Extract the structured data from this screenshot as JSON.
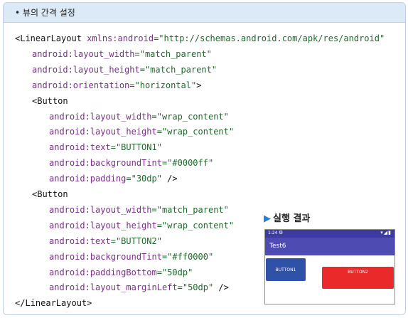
{
  "header": {
    "bullet": "•",
    "title": "뷰의 간격 설정"
  },
  "code_lines": [
    [
      {
        "t": "<LinearLayout ",
        "c": "k"
      },
      {
        "t": "xmlns:android",
        "c": "a"
      },
      {
        "t": "=\"http://schemas.android.com/apk/res/android\"",
        "c": "v"
      }
    ],
    [
      {
        "t": "android:",
        "c": "a"
      },
      {
        "t": "layout_width",
        "c": "a"
      },
      {
        "t": "=\"match_parent\"",
        "c": "v"
      }
    ],
    [
      {
        "t": "android:",
        "c": "a"
      },
      {
        "t": "layout_height",
        "c": "a"
      },
      {
        "t": "=\"match_parent\"",
        "c": "v"
      }
    ],
    [
      {
        "t": "android:",
        "c": "a"
      },
      {
        "t": "orientation",
        "c": "a"
      },
      {
        "t": "=\"horizontal\"",
        "c": "v"
      },
      {
        "t": ">",
        "c": "k"
      }
    ],
    [
      {
        "t": "<Button",
        "c": "k"
      }
    ],
    [
      {
        "t": "android:",
        "c": "a"
      },
      {
        "t": "layout_width",
        "c": "a"
      },
      {
        "t": "=\"wrap_content\"",
        "c": "v"
      }
    ],
    [
      {
        "t": "android:",
        "c": "a"
      },
      {
        "t": "layout_height",
        "c": "a"
      },
      {
        "t": "=\"wrap_content\"",
        "c": "v"
      }
    ],
    [
      {
        "t": "android:",
        "c": "a"
      },
      {
        "t": "text",
        "c": "a"
      },
      {
        "t": "=\"BUTTON1\"",
        "c": "v"
      }
    ],
    [
      {
        "t": "android:",
        "c": "a"
      },
      {
        "t": "backgroundTint",
        "c": "a"
      },
      {
        "t": "=\"#0000ff\"",
        "c": "v"
      }
    ],
    [
      {
        "t": "android:",
        "c": "a"
      },
      {
        "t": "padding",
        "c": "a"
      },
      {
        "t": "=\"30dp\"",
        "c": "v"
      },
      {
        "t": " />",
        "c": "k"
      }
    ],
    [
      {
        "t": "<Button",
        "c": "k"
      }
    ],
    [
      {
        "t": "android:",
        "c": "a"
      },
      {
        "t": "layout_width",
        "c": "a"
      },
      {
        "t": "=\"match_parent\"",
        "c": "v"
      }
    ],
    [
      {
        "t": "android:",
        "c": "a"
      },
      {
        "t": "layout_height",
        "c": "a"
      },
      {
        "t": "=\"wrap_content\"",
        "c": "v"
      }
    ],
    [
      {
        "t": "android:",
        "c": "a"
      },
      {
        "t": "text",
        "c": "a"
      },
      {
        "t": "=\"BUTTON2\"",
        "c": "v"
      }
    ],
    [
      {
        "t": "android:",
        "c": "a"
      },
      {
        "t": "backgroundTint",
        "c": "a"
      },
      {
        "t": "=\"#ff0000\"",
        "c": "v"
      }
    ],
    [
      {
        "t": "android:",
        "c": "a"
      },
      {
        "t": "paddingBottom",
        "c": "a"
      },
      {
        "t": "=\"50dp\"",
        "c": "v"
      }
    ],
    [
      {
        "t": "android:",
        "c": "a"
      },
      {
        "t": "layout_marginLeft",
        "c": "a"
      },
      {
        "t": "=\"50dp\"",
        "c": "v"
      },
      {
        "t": " />",
        "c": "k"
      }
    ],
    [
      {
        "t": "</LinearLayout>",
        "c": "k"
      }
    ]
  ],
  "result": {
    "label": "실행 결과",
    "phone": {
      "time": "1:24",
      "app_title": "Test6",
      "button1": "BUTTON1",
      "button2": "BUTTON2"
    }
  }
}
